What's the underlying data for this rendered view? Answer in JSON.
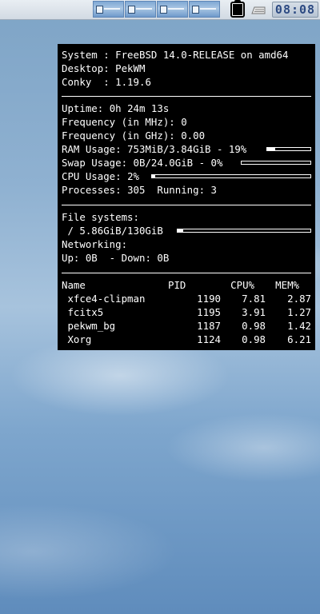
{
  "panel": {
    "desktops": [
      "desktop-1",
      "desktop-2",
      "desktop-3",
      "desktop-4"
    ],
    "clock": "08:08",
    "icons": [
      "clipboard-icon",
      "keyboard-icon"
    ]
  },
  "conky": {
    "system_label": "System : ",
    "system_value": "FreeBSD 14.0-RELEASE on amd64",
    "desktop_label": "Desktop: ",
    "desktop_value": "PekWM",
    "conky_label": "Conky  : ",
    "conky_value": "1.19.6",
    "uptime_label": "Uptime: ",
    "uptime_value": "0h 24m 13s",
    "freq_mhz_label": "Frequency (in MHz): ",
    "freq_mhz_value": "0",
    "freq_ghz_label": "Frequency (in GHz): ",
    "freq_ghz_value": "0.00",
    "ram_label": "RAM Usage: ",
    "ram_value": "753MiB/3.84GiB - 19%",
    "ram_percent": 19,
    "swap_label": "Swap Usage: ",
    "swap_value": "0B/24.0GiB - 0%",
    "swap_percent": 0,
    "cpu_label": "CPU Usage: ",
    "cpu_value": "2%",
    "cpu_percent": 2,
    "processes_label": "Processes: ",
    "processes_value": "305",
    "running_label": "  Running: ",
    "running_value": "3",
    "fs_label": "File systems:",
    "fs_root": " / 5.86GiB/130GiB",
    "fs_percent": 4.5,
    "net_label": "Networking:",
    "up_label": "Up: ",
    "up_value": "0B",
    "down_label": "  - Down: ",
    "down_value": "0B",
    "table_headers": {
      "name": "Name",
      "pid": "PID",
      "cpu": "CPU%",
      "mem": "MEM%"
    },
    "processes": [
      {
        "name": " xfce4-clipman",
        "pid": "1190",
        "cpu": "7.81",
        "mem": "2.87"
      },
      {
        "name": " fcitx5",
        "pid": "1195",
        "cpu": "3.91",
        "mem": "1.27"
      },
      {
        "name": " pekwm_bg",
        "pid": "1187",
        "cpu": "0.98",
        "mem": "1.42"
      },
      {
        "name": " Xorg",
        "pid": "1124",
        "cpu": "0.98",
        "mem": "6.21"
      }
    ]
  }
}
